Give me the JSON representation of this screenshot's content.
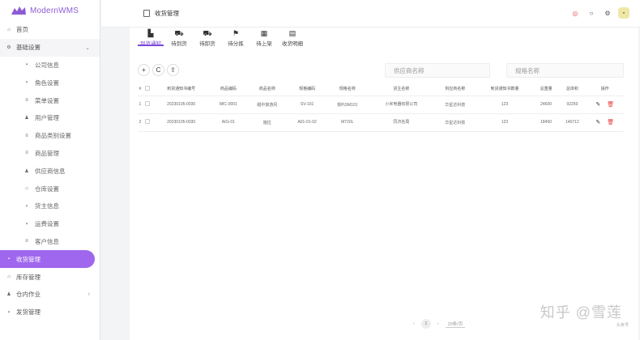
{
  "app": {
    "logo_text": "ModernWMS"
  },
  "sidebar": {
    "items": [
      {
        "label": "首页",
        "icon": "home-icon",
        "glyph": "⌂",
        "kind": "top"
      },
      {
        "label": "基础设置",
        "icon": "gear-icon",
        "glyph": "⚙",
        "kind": "group",
        "chevron": "⌄"
      },
      {
        "label": "公司信息",
        "icon": "building-icon",
        "glyph": "▪",
        "kind": "sub"
      },
      {
        "label": "角色设置",
        "icon": "role-icon",
        "glyph": "▪",
        "kind": "sub"
      },
      {
        "label": "菜单设置",
        "icon": "menu-icon",
        "glyph": "≡",
        "kind": "sub"
      },
      {
        "label": "用户管理",
        "icon": "user-icon",
        "glyph": "♟",
        "kind": "sub"
      },
      {
        "label": "商品类别设置",
        "icon": "category-icon",
        "glyph": "≡",
        "kind": "sub"
      },
      {
        "label": "商品管理",
        "icon": "goods-icon",
        "glyph": "≡",
        "kind": "sub"
      },
      {
        "label": "供应商信息",
        "icon": "supplier-icon",
        "glyph": "♟",
        "kind": "sub"
      },
      {
        "label": "仓库设置",
        "icon": "warehouse-icon",
        "glyph": "⌂",
        "kind": "sub"
      },
      {
        "label": "货主信息",
        "icon": "owner-icon",
        "glyph": "▪",
        "kind": "sub"
      },
      {
        "label": "运费设置",
        "icon": "freight-icon",
        "glyph": "▪",
        "kind": "sub"
      },
      {
        "label": "客户信息",
        "icon": "customer-icon",
        "glyph": "≡",
        "kind": "sub"
      },
      {
        "label": "收货管理",
        "icon": "receive-icon",
        "glyph": "▪",
        "kind": "active"
      },
      {
        "label": "库存管理",
        "icon": "stock-icon",
        "glyph": "⌂",
        "kind": "top"
      },
      {
        "label": "仓内作业",
        "icon": "operation-icon",
        "glyph": "♟",
        "kind": "top",
        "chevron": "›"
      },
      {
        "label": "发货管理",
        "icon": "ship-icon",
        "glyph": "▪",
        "kind": "top"
      }
    ]
  },
  "header": {
    "title": "收货管理",
    "icons": [
      {
        "name": "help-icon",
        "glyph": "◎",
        "cls": "hi-help"
      },
      {
        "name": "github-icon",
        "glyph": "○",
        "cls": "hi-gh"
      },
      {
        "name": "settings-icon",
        "glyph": "⚙",
        "cls": "hi-set"
      },
      {
        "name": "avatar",
        "glyph": "▪",
        "cls": "hi-user"
      }
    ]
  },
  "tabs": [
    {
      "label": "到货通知",
      "icon": "notice-icon",
      "glyph": "▙",
      "active": true
    },
    {
      "label": "待到货",
      "icon": "truck-icon",
      "glyph": "⛟",
      "active": false
    },
    {
      "label": "待卸货",
      "icon": "unload-icon",
      "glyph": "⛟",
      "active": false
    },
    {
      "label": "待分拣",
      "icon": "sort-icon",
      "glyph": "⚑",
      "active": false
    },
    {
      "label": "待上架",
      "icon": "shelf-icon",
      "glyph": "▦",
      "active": false
    },
    {
      "label": "收货明细",
      "icon": "detail-icon",
      "glyph": "▤",
      "active": false
    }
  ],
  "toolbar": {
    "add": "+",
    "refresh": "C",
    "export": "⇪"
  },
  "search": {
    "supplier_placeholder": "供应商名称",
    "spec_placeholder": "规格名称"
  },
  "table": {
    "columns": [
      "#",
      "",
      "到货通知书编号",
      "商品编码",
      "商品名称",
      "规格编码",
      "规格名称",
      "货主名称",
      "供应商名称",
      "到货通知书数量",
      "总重量",
      "总体积",
      "操作"
    ],
    "rows": [
      {
        "idx": "1",
        "no": "20230105-0030",
        "code": "MIC-0001",
        "name": "甜中旅游风",
        "spec_code": "SV-101",
        "spec_name": "铁叭5M101",
        "owner": "小米电器有限公司",
        "supplier": "华星达科技",
        "qty": "123",
        "weight": "24600",
        "volume": "92250"
      },
      {
        "idx": "2",
        "no": "20230105-0030",
        "code": "A01-01",
        "name": "施拉",
        "spec_code": "A01-01-02",
        "spec_name": "M720L",
        "owner": "同济名局",
        "supplier": "华星达科技",
        "qty": "123",
        "weight": "18450",
        "volume": "140712"
      }
    ]
  },
  "pager": {
    "prev": "‹",
    "page": "1",
    "next": "›",
    "size": "20条/页"
  },
  "watermark": {
    "text": "知乎 @雪莲",
    "small": "头条号"
  }
}
